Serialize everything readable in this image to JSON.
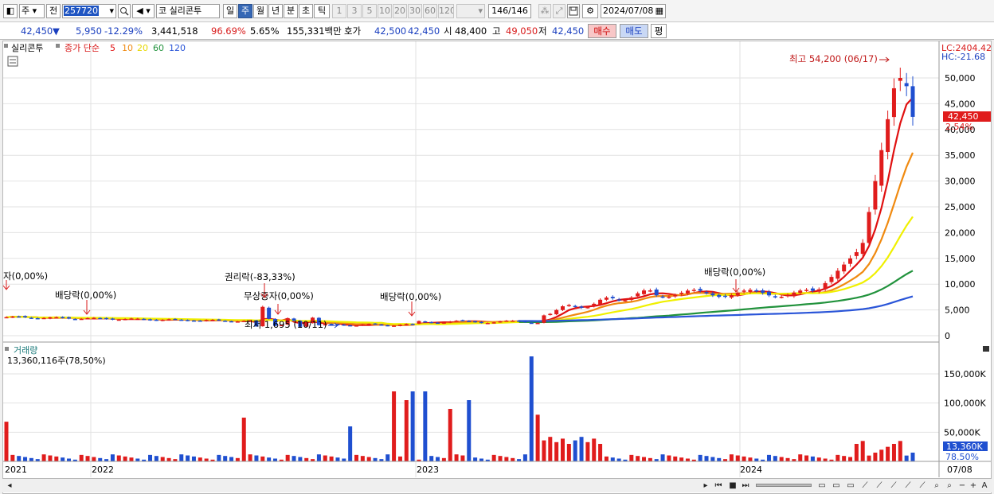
{
  "toolbar": {
    "type_label": "주",
    "prev_label": "전",
    "code_value": "257720",
    "market_label": "코",
    "stock_name": "실리콘투",
    "period_tabs": [
      "일",
      "주",
      "월",
      "년",
      "분",
      "초",
      "틱"
    ],
    "active_period": "주",
    "interval_tabs": [
      "1",
      "3",
      "5",
      "10",
      "20",
      "30",
      "60",
      "120"
    ],
    "count_display": "146/146",
    "date_value": "2024/07/08"
  },
  "quote": {
    "price": "42,450",
    "change_arrow": "▼",
    "change": "5,950",
    "change_pct": "-12.29%",
    "volume": "3,441,518",
    "vol_ratio": "96.69%",
    "turnover_pct": "5.65%",
    "amount": "155,331백만",
    "bid_label": "호가",
    "ask_price": "42,500",
    "bid_price": "42,450",
    "open_label": "시",
    "open": "48,400",
    "high_label": "고",
    "high": "49,050",
    "low_label": "저",
    "low": "42,450",
    "buy_label": "매수",
    "sell_label": "매도",
    "eval_label": "평"
  },
  "legend": {
    "name": "실리콘투",
    "ma_label": "종가 단순",
    "ma_periods": [
      "5",
      "10",
      "20",
      "60",
      "120"
    ],
    "ma_colors": [
      "#e01010",
      "#f08a10",
      "#f0f000",
      "#21923c",
      "#2a55d8"
    ],
    "lc": "LC:2404.42",
    "hc": "HC:-21.68"
  },
  "price_axis": {
    "ticks": [
      "50,000",
      "45,000",
      "40,000",
      "35,000",
      "30,000",
      "25,000",
      "20,000",
      "15,000",
      "10,000",
      "5,000",
      "0"
    ],
    "current_tag": "42,450",
    "pct_tag": "2.54%"
  },
  "annotations": {
    "high_label": "최고 54,200 (06/17)",
    "low_label": "최저 1,695 (10/11)",
    "left_edge": "자(0,00%)",
    "div1": "배당락(0,00%)",
    "rights": "권리락(-83,33%)",
    "bonus": "무상증자(0,00%)",
    "div2": "배당락(0,00%)",
    "div3": "배당락(0,00%)"
  },
  "volume_panel": {
    "title": "거래량",
    "value": "13,360,116주(78,50%)",
    "ticks": [
      "150,000K",
      "100,000K",
      "50,000K"
    ],
    "current_tag": "13,360K",
    "pct_tag": "78.50%"
  },
  "x_axis": {
    "labels": [
      "2021",
      "2022",
      "2023",
      "2024"
    ],
    "end_label": "07/08"
  },
  "colors": {
    "up": "#e01c1c",
    "down": "#1f4fd0",
    "accent": "#3567b5"
  }
}
